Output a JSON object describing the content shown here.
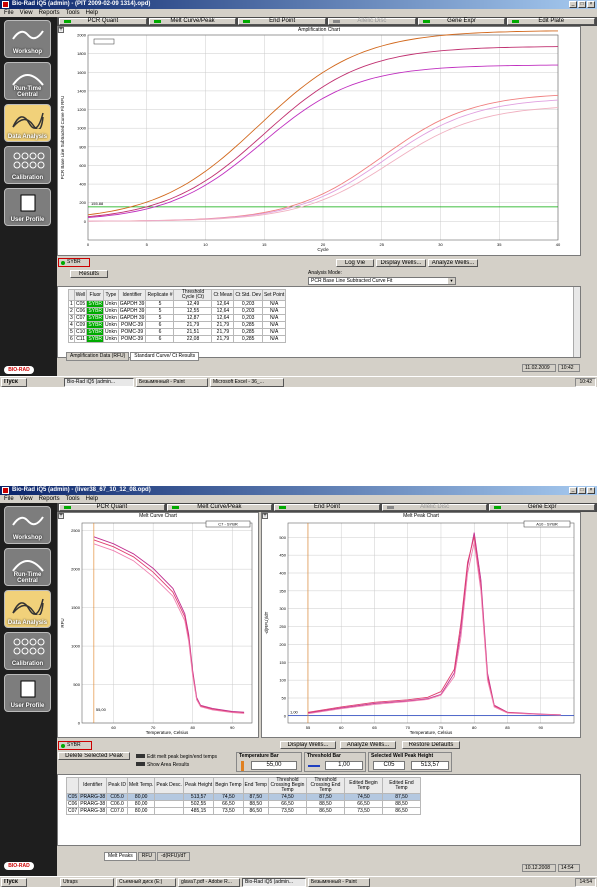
{
  "screens": [
    {
      "window_title": "Bio-Rad iQ5 (admin) - (PIT 2009-02-09 1314).opd)",
      "menu": [
        "File",
        "View",
        "Reports",
        "Tools",
        "Help"
      ],
      "mode_tabs": [
        "PCR Quant",
        "Melt Curve/Peak",
        "End Point",
        "Allelic Disc",
        "Gene Expr",
        "Edit Plate"
      ],
      "sidebar": [
        "Workshop",
        "Run-Time Central",
        "Data Analysis",
        "Calibration",
        "User Profile"
      ],
      "chart_title": "Amplification Chart",
      "y_label": "PCR Base Line Subtracted Curve Fit RFU",
      "x_label": "Cycle",
      "threshold_label": "155.88",
      "fluor_label": "SYBR",
      "buttons": [
        "Log Vie",
        "Display Wells...",
        "Analyze Wells...",
        "Results"
      ],
      "analysis_mode_label": "Analysis Mode:",
      "analysis_mode_value": "PCR Base Line Subtracted Curve Fit",
      "table_headers": [
        "",
        "Well",
        "Fluor",
        "Type",
        "Identifier",
        "Replicate #",
        "Threshold Cycle (Ct)",
        "Ct Mean",
        "Ct Std. Dev",
        "Set Point"
      ],
      "table_rows": [
        [
          "1",
          "C05",
          "SYBR",
          "Unkn",
          "GAPDH 39",
          "5",
          "12,49",
          "12,64",
          "0,203",
          "N/A"
        ],
        [
          "2",
          "C06",
          "SYBR",
          "Unkn",
          "GAPDH 39",
          "5",
          "12,55",
          "12,64",
          "0,203",
          "N/A"
        ],
        [
          "3",
          "C07",
          "SYBR",
          "Unkn",
          "GAPDH 39",
          "5",
          "12,87",
          "12,64",
          "0,203",
          "N/A"
        ],
        [
          "4",
          "C09",
          "SYBR",
          "Unkn",
          "POMC-39",
          "6",
          "21,79",
          "21,79",
          "0,285",
          "N/A"
        ],
        [
          "5",
          "C10",
          "SYBR",
          "Unkn",
          "POMC-39",
          "6",
          "21,51",
          "21,79",
          "0,285",
          "N/A"
        ],
        [
          "6",
          "C11",
          "SYBR",
          "Unkn",
          "POMC-39",
          "6",
          "22,08",
          "21,79",
          "0,285",
          "N/A"
        ]
      ],
      "bottom_tabs": [
        "Amplification Data (RFU)",
        "Standard Curve/ Ct Results"
      ],
      "status_date": "11.02.2009",
      "status_time": "10:42",
      "logo": "BIO-RAD",
      "taskbar": [
        "Пуск",
        "Bio-Rad iQ5 (admin...",
        "Безымянный - Paint",
        "Microsoft Excel - 36_..."
      ],
      "tray_time": "10:42",
      "chart_data": {
        "type": "line",
        "title": "Amplification Chart",
        "xlabel": "Cycle",
        "ylabel": "PCR Base Line Subtracted Curve Fit RFU",
        "xlim": [
          0,
          40
        ],
        "ylim": [
          -200,
          2000
        ],
        "x_ticks": [
          0,
          5,
          10,
          15,
          20,
          25,
          30,
          35,
          40
        ],
        "y_ticks": [
          0,
          200,
          400,
          600,
          800,
          1000,
          1200,
          1400,
          1600,
          1800,
          2000
        ],
        "threshold": 155.88,
        "series": [
          {
            "color": "#d2691e",
            "midpoint": 14.5,
            "plateau": 2050,
            "slope": 0.23
          },
          {
            "color": "#c030c0",
            "midpoint": 14.8,
            "plateau": 1680,
            "slope": 0.25
          },
          {
            "color": "#c03070",
            "midpoint": 15.0,
            "plateau": 1880,
            "slope": 0.24
          },
          {
            "color": "#f08080",
            "midpoint": 25.0,
            "plateau": 1380,
            "slope": 0.26
          },
          {
            "color": "#e0a0e0",
            "midpoint": 25.3,
            "plateau": 1330,
            "slope": 0.26
          },
          {
            "color": "#f0b0c0",
            "midpoint": 25.7,
            "plateau": 1250,
            "slope": 0.26
          }
        ]
      }
    },
    {
      "window_title": "Bio-Rad iQ5 (admin) - (liver38_67_10_12_08.opd)",
      "menu": [
        "File",
        "View",
        "Reports",
        "Tools",
        "Help"
      ],
      "mode_tabs": [
        "PCR Quant",
        "Melt Curve/Peak",
        "End Point",
        "Allelic Disc",
        "Gene Expr"
      ],
      "sidebar": [
        "Workshop",
        "Run-Time Central",
        "Data Analysis",
        "Calibration",
        "User Profile"
      ],
      "melt_curve_title": "Melt Curve Chart",
      "melt_curve_legend": "C7 - SYBR",
      "melt_curve_ylabel": "RFU",
      "melt_curve_xlabel": "Temperature, Celsius",
      "melt_curve_threshold_label": "55,00",
      "melt_peak_title": "Melt Peak Chart",
      "melt_peak_legend": "A10 - SYBR",
      "melt_peak_ylabel": "-d(RFU)/dT",
      "melt_peak_xlabel": "Temperature, Celsius",
      "melt_peak_threshold_label": "1,00",
      "fluor_label": "SYBR",
      "buttons": [
        "Display Wells...",
        "Analyze Wells...",
        "Restore Defaults",
        "Delete Selected Peak"
      ],
      "checkboxes": [
        "Edit melt peak begin/end temps",
        "Show Area Results"
      ],
      "temperature_bar_label": "Temperature Bar",
      "temperature_bar_value": "55,00",
      "threshold_bar_label": "Threshold Bar",
      "threshold_bar_value": "1,00",
      "selected_well_label": "Selected Well Peak Height",
      "selected_well_id": "C05",
      "selected_well_value": "513,57",
      "table_headers": [
        "",
        "Identifier",
        "Peak ID",
        "Melt Temp.",
        "Peak Desc.",
        "Peak Height",
        "Begin Temp",
        "End Temp",
        "Threshold Crossing Begin Temp",
        "Threshold Crossing End Temp",
        "Edited Begin Temp",
        "Edited End Temp"
      ],
      "table_rows": [
        [
          "C05",
          "PRARG-38",
          "C05.0",
          "80,00",
          "",
          "513,57",
          "74,50",
          "87,50",
          "74,50",
          "87,50",
          "74,50",
          "87,50"
        ],
        [
          "C06",
          "PRARG-38",
          "C06.0",
          "80,00",
          "",
          "502,55",
          "66,50",
          "88,50",
          "66,50",
          "88,50",
          "66,50",
          "88,50"
        ],
        [
          "C07",
          "PRARG-38",
          "C07.0",
          "80,00",
          "",
          "485,15",
          "73,50",
          "86,50",
          "73,50",
          "86,50",
          "73,50",
          "86,50"
        ]
      ],
      "bottom_tabs": [
        "Melt Peaks",
        "RFU",
        "-d(RFU)/dT"
      ],
      "status_date": "10.12.2008",
      "status_time": "14:54",
      "logo": "BIO-RAD",
      "taskbar": [
        "Пуск",
        "Utraps",
        "Съемный диск (E:)",
        "glava7.pdf - Adobe R...",
        "Bio-Rad iQ5 (admin...",
        "Безымянный - Paint"
      ],
      "tray_time": "14:54",
      "chart_data": [
        {
          "type": "line",
          "title": "Melt Curve Chart",
          "xlabel": "Temperature, Celsius",
          "ylabel": "RFU",
          "xlim": [
            52,
            95
          ],
          "ylim": [
            0,
            2600
          ],
          "x_ticks": [
            60,
            70,
            80,
            90
          ],
          "y_ticks": [
            0,
            500,
            1000,
            1500,
            2000,
            2500
          ],
          "series": [
            {
              "name": "C05",
              "color": "#c03090",
              "x": [
                55,
                60,
                65,
                70,
                75,
                78,
                79,
                80,
                81,
                82,
                85,
                90,
                93
              ],
              "y": [
                2420,
                2330,
                2200,
                2010,
                1750,
                1420,
                1150,
                680,
                330,
                230,
                190,
                150,
                140
              ]
            },
            {
              "name": "C06",
              "color": "#e04070",
              "x": [
                55,
                60,
                65,
                70,
                75,
                78,
                79,
                80,
                81,
                82,
                85,
                90,
                93
              ],
              "y": [
                2380,
                2290,
                2160,
                1960,
                1700,
                1380,
                1100,
                640,
                310,
                220,
                180,
                140,
                130
              ]
            },
            {
              "name": "C07",
              "color": "#f080b0",
              "x": [
                55,
                60,
                65,
                70,
                75,
                78,
                79,
                80,
                81,
                82,
                85,
                90,
                93
              ],
              "y": [
                2330,
                2240,
                2110,
                1900,
                1650,
                1330,
                1060,
                610,
                300,
                210,
                170,
                135,
                125
              ]
            }
          ]
        },
        {
          "type": "line",
          "title": "Melt Peak Chart",
          "xlabel": "Temperature, Celsius",
          "ylabel": "-d(RFU)/dT",
          "xlim": [
            52,
            95
          ],
          "ylim": [
            -20,
            540
          ],
          "x_ticks": [
            55,
            60,
            65,
            70,
            75,
            80,
            85,
            90
          ],
          "y_ticks": [
            0,
            50,
            100,
            150,
            200,
            250,
            300,
            350,
            400,
            450,
            500
          ],
          "series": [
            {
              "name": "C05",
              "color": "#c03090",
              "x": [
                55,
                60,
                65,
                70,
                73,
                75,
                77,
                78,
                79,
                80,
                81,
                82,
                83,
                85,
                90,
                93
              ],
              "y": [
                8,
                22,
                35,
                42,
                48,
                60,
                120,
                240,
                420,
                513,
                380,
                120,
                30,
                10,
                5,
                3
              ]
            },
            {
              "name": "C06",
              "color": "#e04070",
              "x": [
                55,
                60,
                65,
                70,
                73,
                75,
                77,
                78,
                79,
                80,
                81,
                82,
                83,
                85,
                90,
                93
              ],
              "y": [
                10,
                25,
                38,
                45,
                52,
                68,
                130,
                260,
                430,
                502,
                360,
                110,
                28,
                9,
                4,
                3
              ]
            },
            {
              "name": "C07",
              "color": "#f080b0",
              "x": [
                55,
                60,
                65,
                70,
                73,
                75,
                77,
                78,
                79,
                80,
                81,
                82,
                83,
                85,
                90,
                93
              ],
              "y": [
                6,
                20,
                32,
                40,
                46,
                58,
                110,
                220,
                400,
                485,
                350,
                100,
                25,
                8,
                4,
                2
              ]
            }
          ]
        }
      ]
    }
  ]
}
